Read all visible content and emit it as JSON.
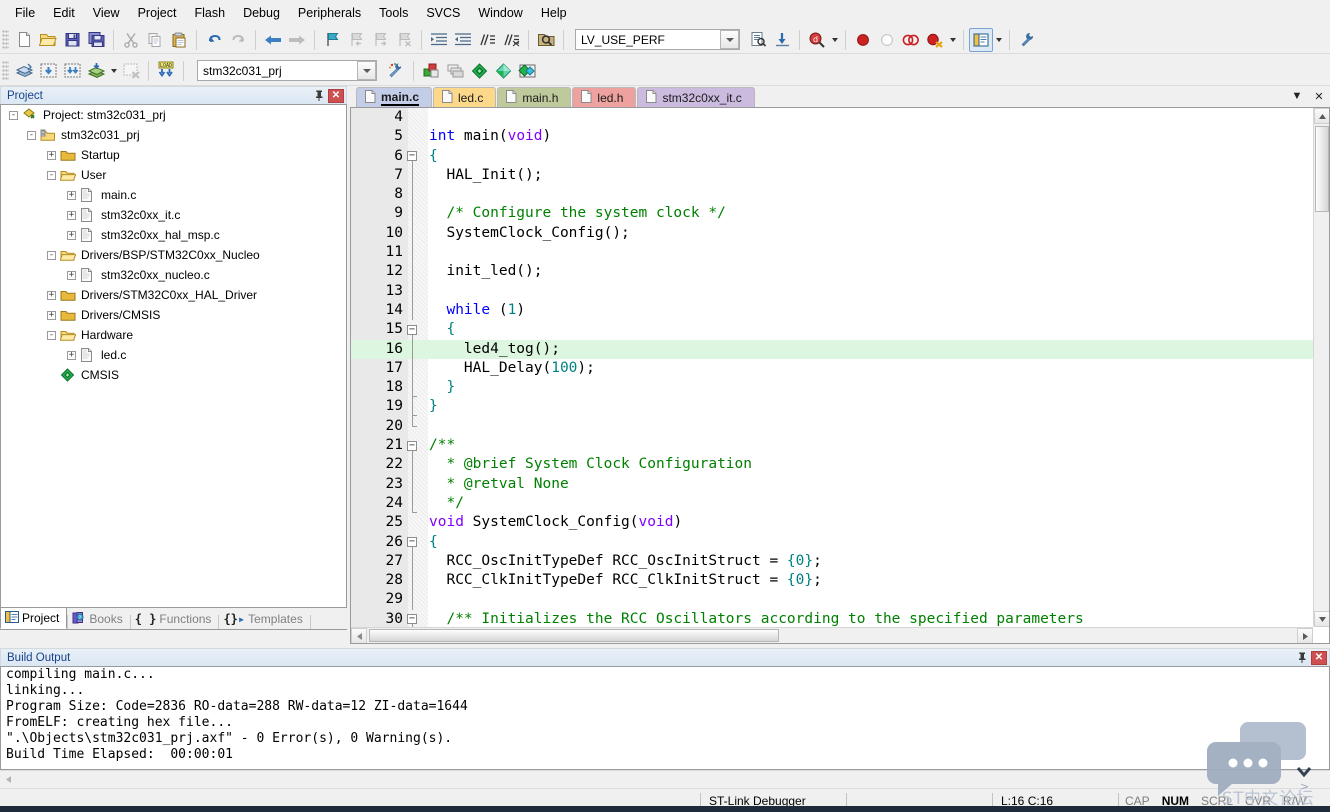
{
  "menu": {
    "items": [
      "File",
      "Edit",
      "View",
      "Project",
      "Flash",
      "Debug",
      "Peripherals",
      "Tools",
      "SVCS",
      "Window",
      "Help"
    ]
  },
  "toolbar_main": {
    "buttons": [
      {
        "name": "new-file-icon",
        "title": "New"
      },
      {
        "name": "open-file-icon",
        "title": "Open"
      },
      {
        "name": "save-icon",
        "title": "Save"
      },
      {
        "name": "save-all-icon",
        "title": "Save All"
      },
      {
        "name": "cut-icon",
        "title": "Cut"
      },
      {
        "name": "copy-icon",
        "title": "Copy"
      },
      {
        "name": "paste-icon",
        "title": "Paste"
      },
      {
        "name": "undo-icon",
        "title": "Undo"
      },
      {
        "name": "redo-icon",
        "title": "Redo"
      },
      {
        "name": "navigate-back-icon",
        "title": "Back"
      },
      {
        "name": "navigate-forward-icon",
        "title": "Forward"
      },
      {
        "name": "bookmark-toggle-icon",
        "title": "Insert/Remove Bookmark"
      },
      {
        "name": "bookmark-prev-icon",
        "title": "Previous Bookmark"
      },
      {
        "name": "bookmark-next-icon",
        "title": "Next Bookmark"
      },
      {
        "name": "bookmark-clear-icon",
        "title": "Clear All Bookmarks"
      },
      {
        "name": "indent-icon",
        "title": "Indent"
      },
      {
        "name": "outdent-icon",
        "title": "Outdent"
      },
      {
        "name": "comment-icon",
        "title": "Comment"
      },
      {
        "name": "uncomment-icon",
        "title": "Uncomment"
      },
      {
        "name": "find-in-files-icon",
        "title": "Find in Files"
      }
    ],
    "search_value": "LV_USE_PERF",
    "search_placeholder": "",
    "after_search": [
      {
        "name": "find-next-icon",
        "title": "Find Next"
      },
      {
        "name": "goto-icon",
        "title": "Go to"
      },
      {
        "name": "debug-find-icon",
        "title": "Browse"
      },
      {
        "name": "breakpoint-insert-icon",
        "title": "Insert/Remove Breakpoint"
      },
      {
        "name": "breakpoint-enable-icon",
        "title": "Enable/Disable Breakpoint"
      },
      {
        "name": "breakpoint-disable-all-icon",
        "title": "Disable All Breakpoints"
      },
      {
        "name": "breakpoint-kill-all-icon",
        "title": "Kill All Breakpoints"
      },
      {
        "name": "project-window-icon",
        "title": "Project Window"
      },
      {
        "name": "configure-icon",
        "title": "Configuration Wizard"
      }
    ]
  },
  "toolbar_build": {
    "buttons": [
      {
        "name": "translate-icon",
        "title": "Translate"
      },
      {
        "name": "build-icon",
        "title": "Build"
      },
      {
        "name": "rebuild-icon",
        "title": "Rebuild"
      },
      {
        "name": "batch-build-icon",
        "title": "Batch Build"
      },
      {
        "name": "stop-build-icon",
        "title": "Stop Build"
      },
      {
        "name": "download-icon",
        "title": "Download"
      }
    ],
    "project_select_value": "stm32c031_prj",
    "after": [
      {
        "name": "target-options-icon",
        "title": "Options for Target"
      },
      {
        "name": "manage-project-items-icon",
        "title": "Manage Project Items"
      },
      {
        "name": "multi-project-icon",
        "title": "Manage Multi-Project"
      },
      {
        "name": "pack-installer-icon",
        "title": "Pack Installer"
      },
      {
        "name": "rte-icon",
        "title": "Manage Run-Time Environment"
      },
      {
        "name": "pack-manage-icon",
        "title": "Select Software Packs"
      }
    ]
  },
  "project_panel": {
    "caption": "Project",
    "pin_icon": "pin-icon",
    "close_icon": "close-icon",
    "tree": [
      {
        "label": "Project: stm32c031_prj",
        "depth": 0,
        "toggle": "-",
        "icon": "project-icon"
      },
      {
        "label": "stm32c031_prj",
        "depth": 1,
        "toggle": "-",
        "icon": "target-icon"
      },
      {
        "label": "Startup",
        "depth": 2,
        "toggle": "+",
        "icon": "folder-closed-icon"
      },
      {
        "label": "User",
        "depth": 2,
        "toggle": "-",
        "icon": "folder-open-icon"
      },
      {
        "label": "main.c",
        "depth": 3,
        "toggle": "+",
        "icon": "c-file-icon"
      },
      {
        "label": "stm32c0xx_it.c",
        "depth": 3,
        "toggle": "+",
        "icon": "c-file-icon"
      },
      {
        "label": "stm32c0xx_hal_msp.c",
        "depth": 3,
        "toggle": "+",
        "icon": "c-file-icon"
      },
      {
        "label": "Drivers/BSP/STM32C0xx_Nucleo",
        "depth": 2,
        "toggle": "-",
        "icon": "folder-open-icon"
      },
      {
        "label": "stm32c0xx_nucleo.c",
        "depth": 3,
        "toggle": "+",
        "icon": "c-file-icon"
      },
      {
        "label": "Drivers/STM32C0xx_HAL_Driver",
        "depth": 2,
        "toggle": "+",
        "icon": "folder-closed-icon"
      },
      {
        "label": "Drivers/CMSIS",
        "depth": 2,
        "toggle": "+",
        "icon": "folder-closed-icon"
      },
      {
        "label": "Hardware",
        "depth": 2,
        "toggle": "-",
        "icon": "folder-open-icon"
      },
      {
        "label": "led.c",
        "depth": 3,
        "toggle": "+",
        "icon": "c-file-icon"
      },
      {
        "label": "CMSIS",
        "depth": 2,
        "toggle": "",
        "icon": "cmsis-icon"
      }
    ],
    "tabs": [
      {
        "label": "Project",
        "icon": "project-tab-icon",
        "active": true
      },
      {
        "label": "Books",
        "icon": "books-icon",
        "active": false
      },
      {
        "label": "Functions",
        "icon": "functions-icon",
        "active": false
      },
      {
        "label": "Templates",
        "icon": "templates-icon",
        "active": false
      }
    ]
  },
  "editor": {
    "tabs": [
      {
        "label": "main.c",
        "active": true,
        "color": "#c3cde8"
      },
      {
        "label": "led.c",
        "active": false,
        "color": "#fbd88a"
      },
      {
        "label": "main.h",
        "active": false,
        "color": "#bfca9c"
      },
      {
        "label": "led.h",
        "active": false,
        "color": "#eea2a0"
      },
      {
        "label": "stm32c0xx_it.c",
        "active": false,
        "color": "#cbbbdf"
      }
    ],
    "tab_menu_icon": "chevron-down-icon",
    "tab_close_icon": "close-icon",
    "highlight_line": 16,
    "lines": [
      {
        "n": 4,
        "fold": "",
        "text": ""
      },
      {
        "n": 5,
        "fold": "",
        "text": "int main(void)",
        "tok": [
          [
            "kw",
            "int"
          ],
          [
            "p",
            " "
          ],
          [
            "t",
            "main"
          ],
          [
            "b",
            "("
          ],
          [
            "kw2",
            "void"
          ],
          [
            "b",
            ")"
          ]
        ]
      },
      {
        "n": 6,
        "fold": "box-",
        "text": "{"
      },
      {
        "n": 7,
        "fold": "bar",
        "text": "  HAL_Init();"
      },
      {
        "n": 8,
        "fold": "bar",
        "text": ""
      },
      {
        "n": 9,
        "fold": "bar",
        "text": "  /* Configure the system clock */",
        "style": "cmt"
      },
      {
        "n": 10,
        "fold": "bar",
        "text": "  SystemClock_Config();"
      },
      {
        "n": 11,
        "fold": "bar",
        "text": ""
      },
      {
        "n": 12,
        "fold": "bar",
        "text": "  init_led();"
      },
      {
        "n": 13,
        "fold": "bar",
        "text": ""
      },
      {
        "n": 14,
        "fold": "bar",
        "text": "  while (1)"
      },
      {
        "n": 15,
        "fold": "box-",
        "text": "  {"
      },
      {
        "n": 16,
        "fold": "bar",
        "text": "    led4_tog();"
      },
      {
        "n": 17,
        "fold": "bar",
        "text": "    HAL_Delay(100);"
      },
      {
        "n": 18,
        "fold": "endin",
        "text": "  }"
      },
      {
        "n": 19,
        "fold": "end",
        "text": "}"
      },
      {
        "n": 20,
        "fold": "endout",
        "text": ""
      },
      {
        "n": 21,
        "fold": "box-",
        "text": "/**",
        "style": "cmt"
      },
      {
        "n": 22,
        "fold": "bar",
        "text": "  * @brief System Clock Configuration",
        "style": "cmt"
      },
      {
        "n": 23,
        "fold": "bar",
        "text": "  * @retval None",
        "style": "cmt"
      },
      {
        "n": 24,
        "fold": "end",
        "text": "  */",
        "style": "cmt"
      },
      {
        "n": 25,
        "fold": "",
        "text": "void SystemClock_Config(void)"
      },
      {
        "n": 26,
        "fold": "box-",
        "text": "{"
      },
      {
        "n": 27,
        "fold": "bar",
        "text": "  RCC_OscInitTypeDef RCC_OscInitStruct = {0};"
      },
      {
        "n": 28,
        "fold": "bar",
        "text": "  RCC_ClkInitTypeDef RCC_ClkInitStruct = {0};"
      },
      {
        "n": 29,
        "fold": "bar",
        "text": ""
      },
      {
        "n": 30,
        "fold": "box-",
        "text": "  /** Initializes the RCC Oscillators according to the specified parameters",
        "style": "cmt"
      }
    ]
  },
  "build_output": {
    "caption": "Build Output",
    "pin_icon": "pin-icon",
    "close_icon": "close-icon",
    "lines": [
      "compiling main.c...",
      "linking...",
      "Program Size: Code=2836 RO-data=288 RW-data=12 ZI-data=1644",
      "FromELF: creating hex file...",
      "\".\\Objects\\stm32c031_prj.axf\" - 0 Error(s), 0 Warning(s).",
      "Build Time Elapsed:  00:00:01"
    ]
  },
  "statusbar": {
    "debugger": "ST-Link Debugger",
    "cursor": "L:16 C:16",
    "indicators": [
      {
        "label": "CAP",
        "on": false
      },
      {
        "label": "NUM",
        "on": true
      },
      {
        "label": "SCRL",
        "on": false
      },
      {
        "label": "OVR",
        "on": false
      },
      {
        "label": "R/W",
        "on": false
      }
    ]
  },
  "watermark": {
    "text": "ST中文论坛",
    "icon": "chat-bubble-icon"
  },
  "colors": {
    "caption_text": "#15428b",
    "keyword": "#0000ff",
    "type_keyword": "#7f00ff",
    "comment": "#008000",
    "number": "#008080",
    "highlight_line_bg": "#ddf6e0",
    "close_button": "#cf5050"
  }
}
